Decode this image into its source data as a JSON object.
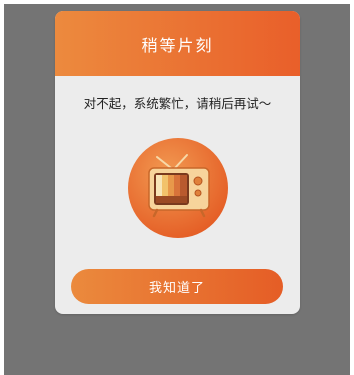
{
  "dialog": {
    "title": "稍等片刻",
    "message": "对不起，系统繁忙，请稍后再试～",
    "illustration": "tv-icon",
    "button_label": "我知道了"
  },
  "colors": {
    "accent_start": "#ec8a3e",
    "accent_end": "#e95f2a",
    "overlay": "#747474",
    "dialog_bg": "#ececec"
  }
}
